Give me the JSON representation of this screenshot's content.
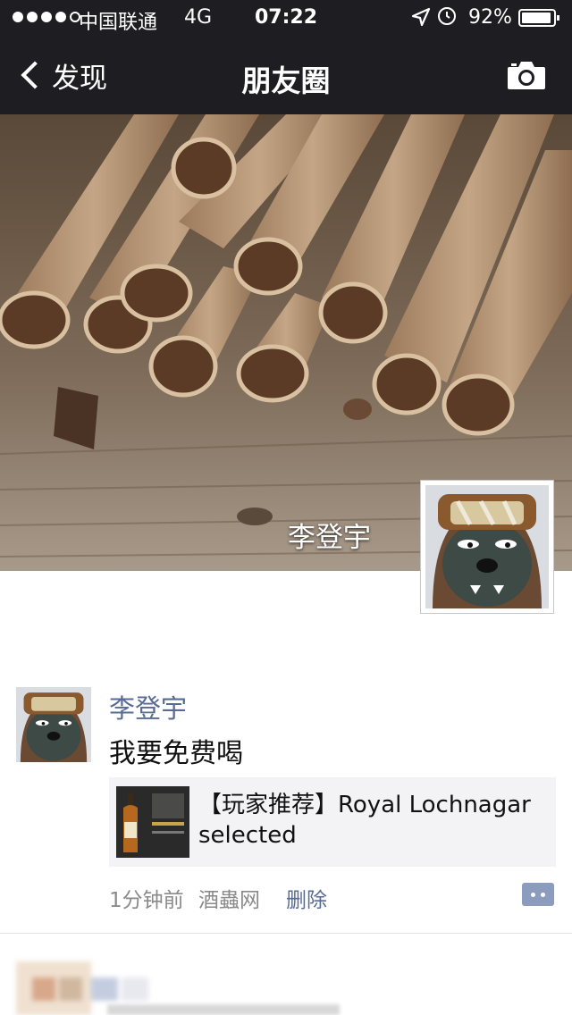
{
  "status_bar": {
    "carrier": "中国联通",
    "network": "4G",
    "time": "07:22",
    "battery_percent": "92%",
    "icons": [
      "signal-dots",
      "location-arrow-icon",
      "alarm-clock-icon",
      "battery-icon"
    ]
  },
  "nav": {
    "back_label": "发现",
    "title": "朋友圈",
    "right_icon": "camera-icon"
  },
  "cover": {
    "username": "李登宇"
  },
  "post": {
    "author": "李登宇",
    "text": "我要免费喝",
    "link": {
      "title": "【玩家推荐】Royal Lochnagar selected"
    },
    "time_ago": "1分钟前",
    "source": "酒蟲网",
    "delete_label": "删除"
  },
  "colors": {
    "nav_background": "#1e1d22",
    "name_link": "#576b95",
    "card_background": "#f3f3f5",
    "comment_button": "#8c9cbf"
  }
}
